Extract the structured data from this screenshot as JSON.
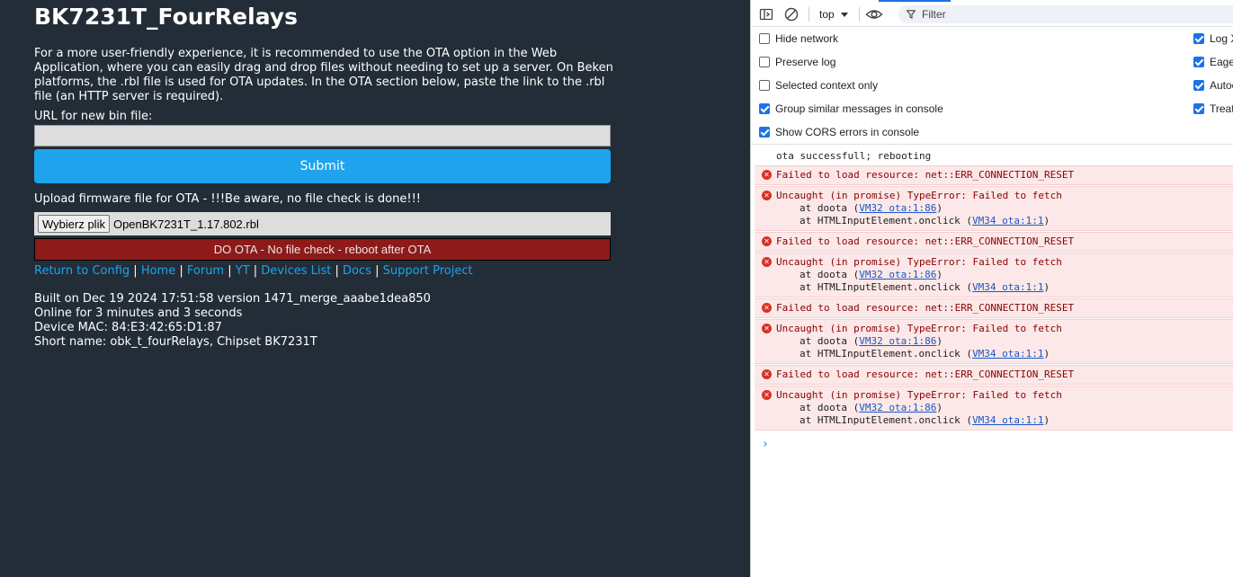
{
  "page": {
    "title": "BK7231T_FourRelays",
    "intro": "For a more user-friendly experience, it is recommended to use the OTA option in the Web Application, where you can easily drag and drop files without needing to set up a server. On Beken platforms, the .rbl file is used for OTA updates. In the OTA section below, paste the link to the .rbl file (an HTTP server is required).",
    "url_label": "URL for new bin file:",
    "url_value": "",
    "submit_label": "Submit",
    "upload_label": "Upload firmware file for OTA - !!!Be aware, no file check is done!!!",
    "file_button": "Wybierz plik",
    "file_name": "OpenBK7231T_1.17.802.rbl",
    "ota_button": "DO OTA - No file check - reboot after OTA",
    "links": [
      "Return to Config",
      "Home",
      "Forum",
      "YT",
      "Devices List",
      "Docs",
      "Support Project"
    ],
    "link_separator": " | ",
    "info": [
      "Built on Dec 19 2024 17:51:58 version 1471_merge_aaabe1dea850",
      "Online for 3 minutes and 3 seconds",
      "Device MAC: 84:E3:42:65:D1:87",
      "Short name: obk_t_fourRelays, Chipset BK7231T"
    ]
  },
  "devtools": {
    "context": "top",
    "filter_placeholder": "Filter",
    "options_left": [
      {
        "label": "Hide network",
        "checked": false
      },
      {
        "label": "Preserve log",
        "checked": false
      },
      {
        "label": "Selected context only",
        "checked": false
      },
      {
        "label": "Group similar messages in console",
        "checked": true
      },
      {
        "label": "Show CORS errors in console",
        "checked": true
      }
    ],
    "options_right": [
      {
        "label": "Log X",
        "checked": true
      },
      {
        "label": "Eage",
        "checked": true
      },
      {
        "label": "Autoc",
        "checked": true
      },
      {
        "label": "Treat",
        "checked": true
      }
    ],
    "info_message": "ota successfull; rebooting",
    "messages": [
      {
        "text": "Failed to load resource: net::ERR_CONNECTION_RESET"
      },
      {
        "text": "Uncaught (in promise) TypeError: Failed to fetch",
        "stack": [
          [
            "at doota (",
            "VM32 ota:1:86",
            ")"
          ],
          [
            "at HTMLInputElement.onclick (",
            "VM34 ota:1:1",
            ")"
          ]
        ]
      },
      {
        "text": "Failed to load resource: net::ERR_CONNECTION_RESET"
      },
      {
        "text": "Uncaught (in promise) TypeError: Failed to fetch",
        "stack": [
          [
            "at doota (",
            "VM32 ota:1:86",
            ")"
          ],
          [
            "at HTMLInputElement.onclick (",
            "VM34 ota:1:1",
            ")"
          ]
        ]
      },
      {
        "text": "Failed to load resource: net::ERR_CONNECTION_RESET"
      },
      {
        "text": "Uncaught (in promise) TypeError: Failed to fetch",
        "stack": [
          [
            "at doota (",
            "VM32 ota:1:86",
            ")"
          ],
          [
            "at HTMLInputElement.onclick (",
            "VM34 ota:1:1",
            ")"
          ]
        ]
      },
      {
        "text": "Failed to load resource: net::ERR_CONNECTION_RESET"
      },
      {
        "text": "Uncaught (in promise) TypeError: Failed to fetch",
        "stack": [
          [
            "at doota (",
            "VM32 ota:1:86",
            ")"
          ],
          [
            "at HTMLInputElement.onclick (",
            "VM34 ota:1:1",
            ")"
          ]
        ]
      }
    ],
    "prompt_glyph": "›",
    "icons": [
      "sidebar-toggle-icon",
      "clear-console-icon",
      "eye-icon",
      "filter-icon",
      "chevron-down-icon",
      "error-icon"
    ],
    "colors": {
      "page_bg": "#222d37",
      "submit": "#1fa3ec",
      "ota": "#8e1a1a",
      "link": "#1fa3ec",
      "error_bg": "#fce8e8",
      "error_text": "#8b0000"
    }
  }
}
